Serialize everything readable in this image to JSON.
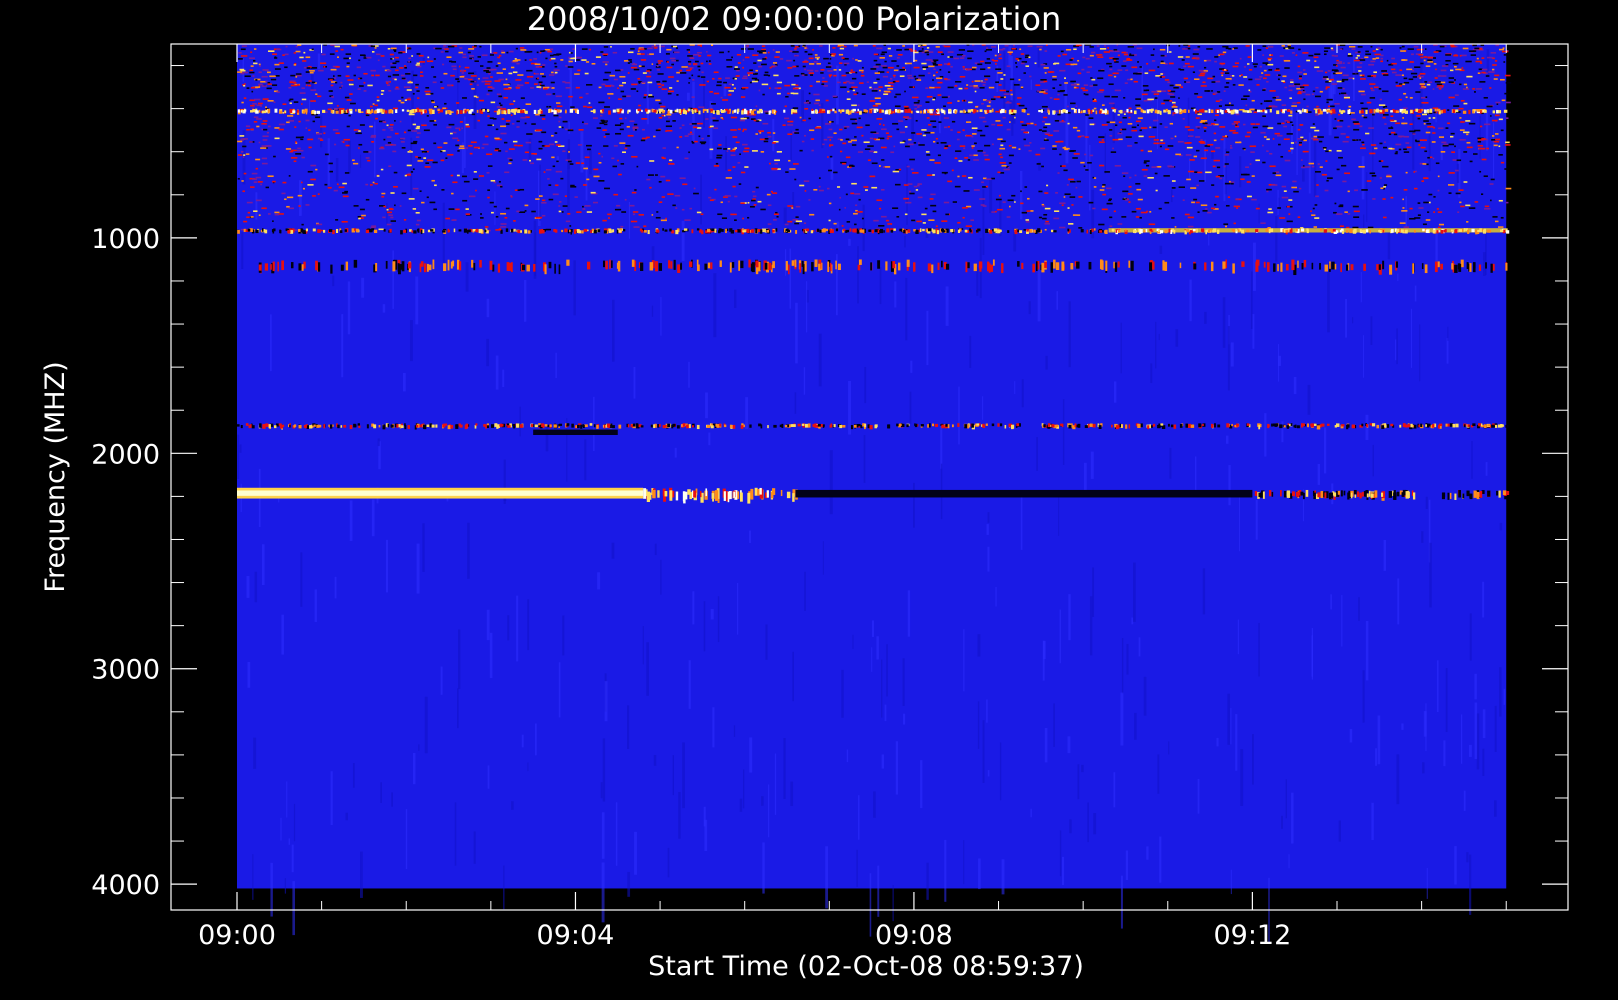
{
  "chart_data": {
    "type": "heatmap",
    "title": "2008/10/02 09:00:00 Polarization",
    "xlabel": "Start Time (02-Oct-08 08:59:37)",
    "ylabel": "Frequency (MHZ)",
    "x_tick_labels": [
      "09:00",
      "09:04",
      "09:08",
      "09:12"
    ],
    "x_ticks_minutes_after_0900": [
      0,
      4,
      8,
      12
    ],
    "x_range_minutes_after_0900": [
      -0.78,
      15.73
    ],
    "x_data_range_minutes_after_0900": [
      0,
      15
    ],
    "y_tick_labels": [
      "1000",
      "2000",
      "3000",
      "4000"
    ],
    "y_ticks": [
      1000,
      2000,
      3000,
      4000
    ],
    "y_range": [
      100,
      4120
    ],
    "y_data_range": [
      100,
      4020
    ],
    "y_reversed": true,
    "colormap": [
      "#000000",
      "#0000ff",
      "#ff0000",
      "#ffa500",
      "#ffff80",
      "#ffffff"
    ],
    "background_value_color": "#1a1ae6",
    "features": [
      {
        "freq_mhz": [
          100,
          960
        ],
        "time_min": [
          0,
          15
        ],
        "level": "noisy"
      },
      {
        "freq_mhz": [
          400,
          420
        ],
        "time_min": [
          0,
          15
        ],
        "level": "high"
      },
      {
        "freq_mhz": [
          955,
          975
        ],
        "time_min": [
          0,
          10.3
        ],
        "level": "mixed"
      },
      {
        "freq_mhz": [
          955,
          975
        ],
        "time_min": [
          10.3,
          15
        ],
        "level": "high"
      },
      {
        "freq_mhz": [
          1100,
          1150
        ],
        "time_min": [
          0,
          15
        ],
        "level": "speckle"
      },
      {
        "freq_mhz": [
          1860,
          1880
        ],
        "time_min": [
          0,
          15
        ],
        "level": "mixed"
      },
      {
        "freq_mhz": [
          1890,
          1915
        ],
        "time_min": [
          3.5,
          4.5
        ],
        "level": "low"
      },
      {
        "freq_mhz": [
          2160,
          2210
        ],
        "time_min": [
          0,
          4.8
        ],
        "level": "very_high"
      },
      {
        "freq_mhz": [
          2160,
          2210
        ],
        "time_min": [
          4.8,
          6.6
        ],
        "level": "high"
      },
      {
        "freq_mhz": [
          2170,
          2205
        ],
        "time_min": [
          6.6,
          12.0
        ],
        "level": "low"
      },
      {
        "freq_mhz": [
          2170,
          2205
        ],
        "time_min": [
          12.0,
          15
        ],
        "level": "mixed"
      }
    ]
  }
}
